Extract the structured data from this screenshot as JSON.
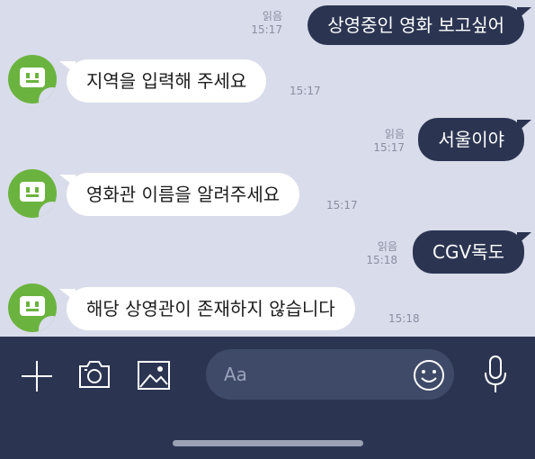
{
  "messages": [
    {
      "side": "sent",
      "text": "상영중인 영화 보고싶어",
      "read": "읽음",
      "time": "15:17"
    },
    {
      "side": "received",
      "text": "지역을 입력해 주세요",
      "time": "15:17"
    },
    {
      "side": "sent",
      "text": "서울이야",
      "read": "읽음",
      "time": "15:17"
    },
    {
      "side": "received",
      "text": "영화관 이름을 알려주세요",
      "time": "15:17"
    },
    {
      "side": "sent",
      "text": "CGV독도",
      "read": "읽음",
      "time": "15:18"
    },
    {
      "side": "received",
      "text": "해당 상영관이 존재하지 않습니다",
      "time": "15:18"
    }
  ],
  "input": {
    "placeholder": "Aa"
  },
  "icons": {
    "plus": "plus-icon",
    "camera": "camera-icon",
    "gallery": "image-icon",
    "emoji": "emoji-icon",
    "mic": "microphone-icon"
  },
  "colors": {
    "bg": "#d9dcea",
    "sent_bubble": "#2b3552",
    "received_bubble": "#ffffff",
    "bar": "#2b3552",
    "avatar": "#6bb33f"
  }
}
